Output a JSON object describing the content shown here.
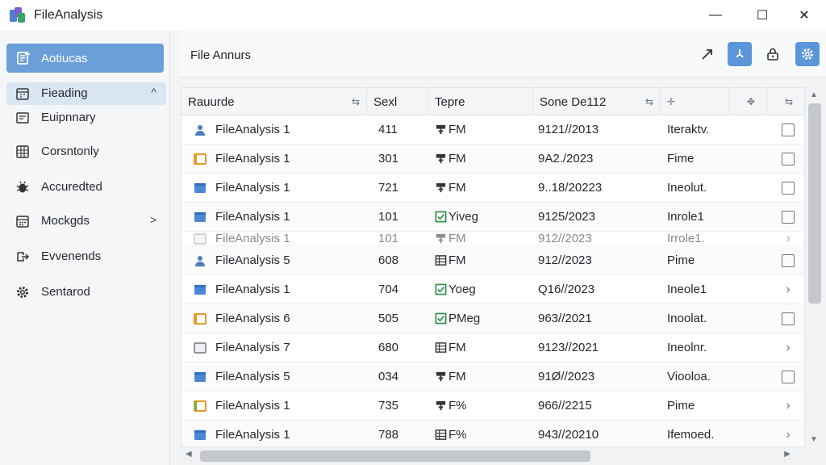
{
  "window": {
    "title": "FileAnalysis",
    "controls": {
      "minimize": "—",
      "maximize": "☐",
      "close": "✕"
    }
  },
  "sidebar": {
    "primary": {
      "label": "Aotiucas",
      "icon": "document-add-icon"
    },
    "items": [
      {
        "label": "Fieading",
        "icon": "calendar-icon",
        "chevron": "^"
      },
      {
        "label": "Euipnnary",
        "icon": "summary-icon",
        "chevron": ""
      },
      {
        "label": "Corsntonly",
        "icon": "grid-icon",
        "chevron": ""
      },
      {
        "label": "Accuredted",
        "icon": "bug-icon",
        "chevron": ""
      },
      {
        "label": "Mockgds",
        "icon": "calendar-grid-icon",
        "chevron": ">"
      },
      {
        "label": "Evvenends",
        "icon": "export-icon",
        "chevron": ""
      },
      {
        "label": "Sentarod",
        "icon": "gear-icon",
        "chevron": ""
      }
    ]
  },
  "main": {
    "title": "File Annurs",
    "toolbar": {
      "expand_icon": "expand-arrow-icon",
      "pin_icon": "pin-icon",
      "lock_icon": "lock-icon",
      "settings_icon": "gear-icon"
    }
  },
  "table": {
    "columns": [
      {
        "label": "Rauurde",
        "sort": "⇆"
      },
      {
        "label": "Sexl",
        "sort": ""
      },
      {
        "label": "Tepre",
        "sort": ""
      },
      {
        "label": "Sone De112",
        "sort": "⇆"
      },
      {
        "label": "",
        "sort": "✛"
      },
      {
        "label": "",
        "sort": "✥"
      },
      {
        "label": "",
        "sort": "⇆"
      }
    ],
    "rows": [
      {
        "name": "FileAnalysis 1",
        "icon": "user-icon",
        "icon_color": "#4a7fc1",
        "size": "411",
        "type": "FM",
        "type_icon": "tree-icon",
        "date": "9121//2013",
        "status": "Iteraktv.",
        "action": "box"
      },
      {
        "name": "FileAnalysis 1",
        "icon": "folder-icon",
        "icon_color": "#e39a2b",
        "size": "301",
        "type": "FM",
        "type_icon": "tree-icon",
        "date": "9А2./2023",
        "status": "Fime",
        "action": "box"
      },
      {
        "name": "FileAnalysis 1",
        "icon": "window-icon",
        "icon_color": "#4a88d6",
        "size": "721",
        "type": "FM",
        "type_icon": "tree-icon",
        "date": "9..18/20223",
        "status": "Ineolut.",
        "action": "box"
      },
      {
        "name": "FileAnalysis 1",
        "icon": "window-icon",
        "icon_color": "#4a88d6",
        "size": "101",
        "type": "Yiveg",
        "type_icon": "check-icon",
        "date": "9125/2023",
        "status": "Inrole1",
        "action": "box"
      },
      {
        "name": "FileAnalysis 1",
        "icon": "window-outline-icon",
        "icon_color": "#9aa0a6",
        "size": "101",
        "type": "FM",
        "type_icon": "tree-icon",
        "date": "912//2023",
        "status": "Irrole1.",
        "action": "chevron",
        "faded": true
      },
      {
        "name": "FileAnalysis 5",
        "icon": "user-icon",
        "icon_color": "#4a7fc1",
        "size": "608",
        "type": "FM",
        "type_icon": "table-icon",
        "date": "912//2023",
        "status": "Pime",
        "action": "box"
      },
      {
        "name": "FileAnalysis 1",
        "icon": "window-icon",
        "icon_color": "#4a88d6",
        "size": "704",
        "type": "Yoeg",
        "type_icon": "check-icon",
        "date": "Q16//2023",
        "status": "Ineole1",
        "action": "chevron"
      },
      {
        "name": "FileAnalysis 6",
        "icon": "folder-icon",
        "icon_color": "#e39a2b",
        "size": "505",
        "type": "PMeg",
        "type_icon": "check-icon",
        "date": "963//2021",
        "status": "Inoolat.",
        "action": "box"
      },
      {
        "name": "FileAnalysis 7",
        "icon": "window-outline-icon",
        "icon_color": "#6e7781",
        "size": "680",
        "type": "FM",
        "type_icon": "table-icon",
        "date": "9123//2021",
        "status": "Ineolnr.",
        "action": "chevron"
      },
      {
        "name": "FileAnalysis 5",
        "icon": "window-icon",
        "icon_color": "#4a88d6",
        "size": "034",
        "type": "FM",
        "type_icon": "tree-icon",
        "date": "91Ø//2023",
        "status": "Viooloa.",
        "action": "box"
      },
      {
        "name": "FileAnalysis 1",
        "icon": "folder-color-icon",
        "icon_color": "#7bb344",
        "size": "735",
        "type": "F%",
        "type_icon": "tree-icon",
        "date": "966//2215",
        "status": "Pime",
        "action": "chevron"
      },
      {
        "name": "FileAnalysis 1",
        "icon": "window-icon",
        "icon_color": "#4a88d6",
        "size": "788",
        "type": "F%",
        "type_icon": "table-icon",
        "date": "943//20210",
        "status": "Ifemoed.",
        "action": "chevron"
      }
    ]
  },
  "scrollbars": {
    "vertical": "vertical-scrollbar",
    "horizontal": "horizontal-scrollbar"
  }
}
